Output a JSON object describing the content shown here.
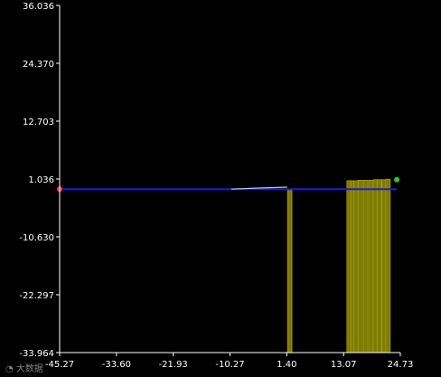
{
  "chart_data": {
    "type": "bar",
    "title": "",
    "xlabel": "",
    "ylabel": "",
    "xlim": [
      -45.27,
      24.73
    ],
    "ylim": [
      -33.964,
      36.036
    ],
    "xticks": [
      "-45.27",
      "-33.60",
      "-21.93",
      "-10.27",
      "1.40",
      "13.07",
      "24.73"
    ],
    "yticks": [
      "36.036",
      "24.370",
      "12.703",
      "1.036",
      "-10.630",
      "-22.297",
      "-33.964"
    ],
    "grid": false,
    "bars": [
      {
        "x": 2.0,
        "y0": -33.964,
        "y1": -1.0
      },
      {
        "x": 14.2,
        "y0": -33.964,
        "y1": 0.7
      },
      {
        "x": 15.0,
        "y0": -33.964,
        "y1": 0.7
      },
      {
        "x": 15.6,
        "y0": -33.964,
        "y1": 0.7
      },
      {
        "x": 16.5,
        "y0": -33.964,
        "y1": 0.8
      },
      {
        "x": 17.6,
        "y0": -33.964,
        "y1": 0.8
      },
      {
        "x": 18.7,
        "y0": -33.964,
        "y1": 0.8
      },
      {
        "x": 19.6,
        "y0": -33.964,
        "y1": 0.9
      },
      {
        "x": 20.4,
        "y0": -33.964,
        "y1": 0.9
      },
      {
        "x": 21.4,
        "y0": -33.964,
        "y1": 0.9
      },
      {
        "x": 22.2,
        "y0": -33.964,
        "y1": 1.0
      }
    ],
    "series": [
      {
        "type": "line",
        "color": "#1a1adf",
        "x": [
          -45.27,
          24.0
        ],
        "y": [
          -1.0,
          -1.0
        ]
      },
      {
        "type": "line",
        "color": "#c8c8c8",
        "x": [
          -10.0,
          -5.0,
          1.5
        ],
        "y": [
          -1.0,
          -0.8,
          -0.6
        ]
      }
    ],
    "markers": [
      {
        "x": -45.27,
        "y": -1.0,
        "color": "#ff3030"
      },
      {
        "x": 24.0,
        "y": 0.9,
        "color": "#22cc22"
      }
    ],
    "colors": {
      "bar_fill": "#7f7a00",
      "bar_edge": "#b5ad1a",
      "axis": "#ffffff",
      "background": "#000000"
    }
  },
  "watermark": "大数据"
}
